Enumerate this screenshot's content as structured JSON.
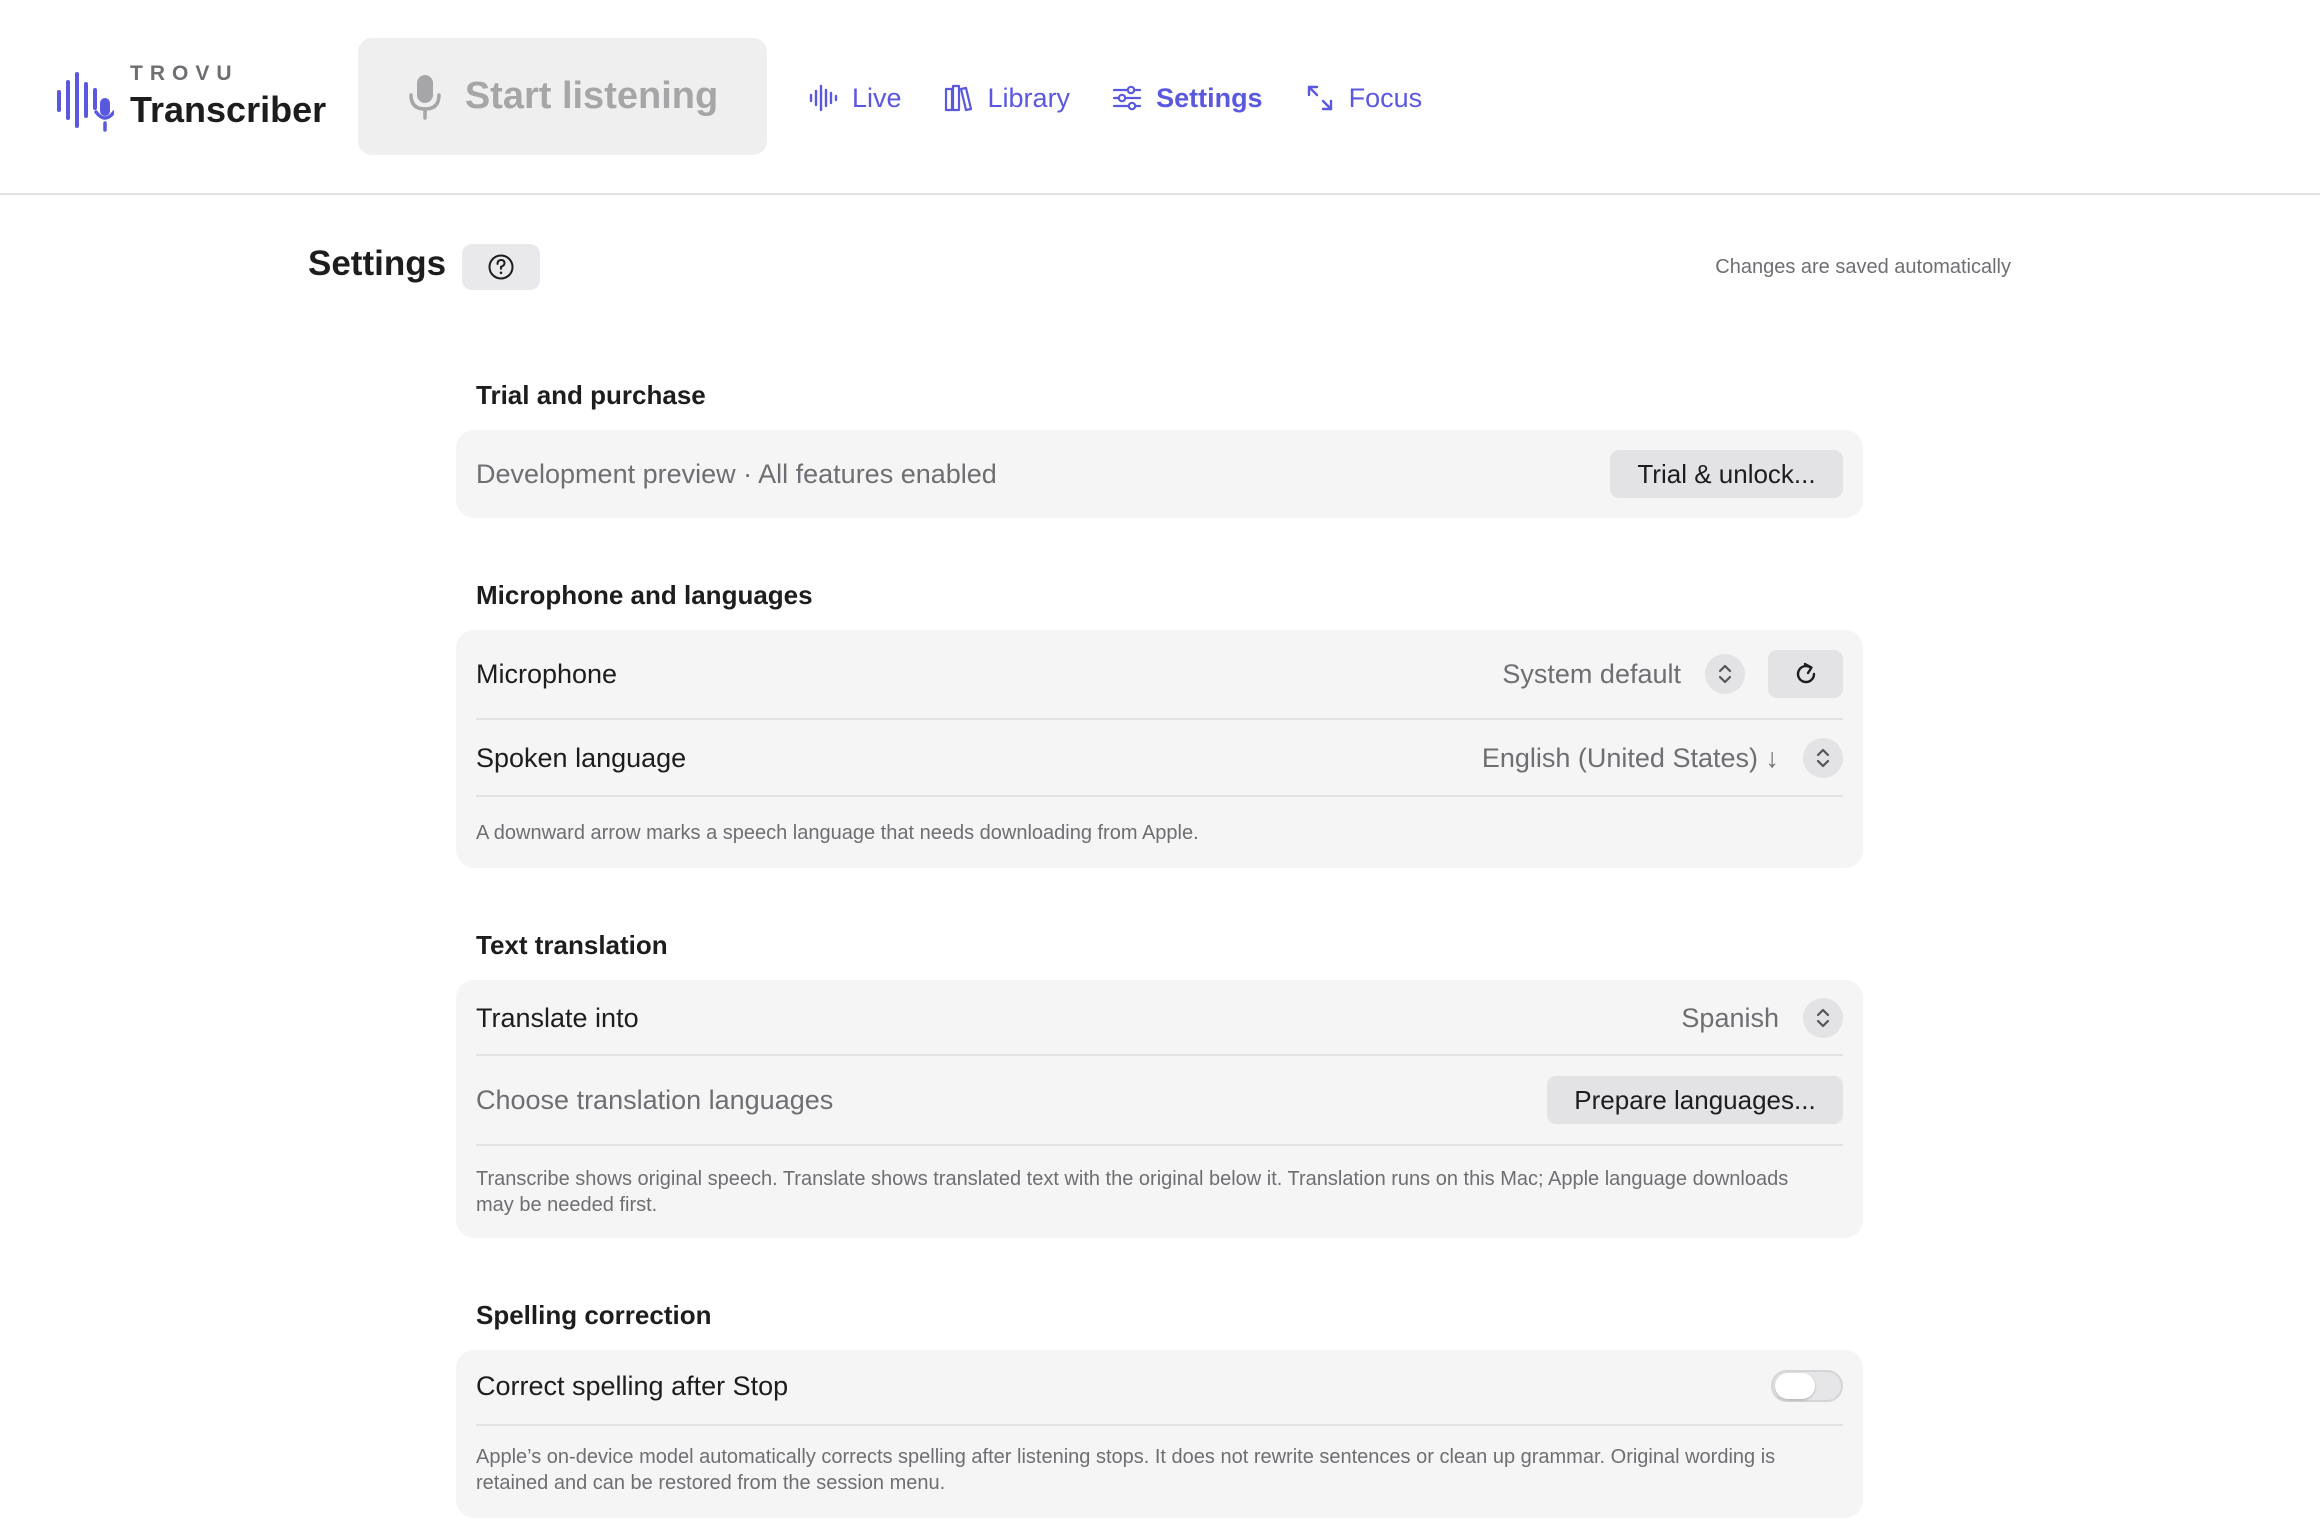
{
  "brand": {
    "small": "TROVU",
    "name": "Transcriber"
  },
  "start_button": {
    "label": "Start listening"
  },
  "nav": {
    "items": [
      {
        "label": "Live",
        "icon": "waveform-icon"
      },
      {
        "label": "Library",
        "icon": "books-icon"
      },
      {
        "label": "Settings",
        "icon": "sliders-icon",
        "active": true
      },
      {
        "label": "Focus",
        "icon": "expand-icon"
      }
    ]
  },
  "page": {
    "title": "Settings",
    "autosave_note": "Changes are saved automatically"
  },
  "sections": {
    "trial": {
      "title": "Trial and purchase",
      "status": "Development preview · All features enabled",
      "button": "Trial & unlock..."
    },
    "mic": {
      "title": "Microphone and languages",
      "microphone_label": "Microphone",
      "microphone_value": "System default",
      "language_label": "Spoken language",
      "language_value": "English (United States) ↓",
      "hint": "A downward arrow marks a speech language that needs downloading from Apple."
    },
    "translation": {
      "title": "Text translation",
      "translate_label": "Translate into",
      "translate_value": "Spanish",
      "choose_label": "Choose translation languages",
      "prepare_button": "Prepare languages...",
      "hint": "Transcribe shows original speech. Translate shows translated text with the original below it. Translation runs on this Mac; Apple language downloads may be needed first."
    },
    "spelling": {
      "title": "Spelling correction",
      "toggle_label": "Correct spelling after Stop",
      "toggle_on": false,
      "hint": "Apple’s on-device model automatically corrects spelling after listening stops. It does not rewrite sentences or clean up grammar. Original wording is retained and can be restored from the session menu."
    }
  },
  "colors": {
    "accent": "#5b58e0",
    "card": "#f5f5f5",
    "button": "#e3e3e5"
  }
}
